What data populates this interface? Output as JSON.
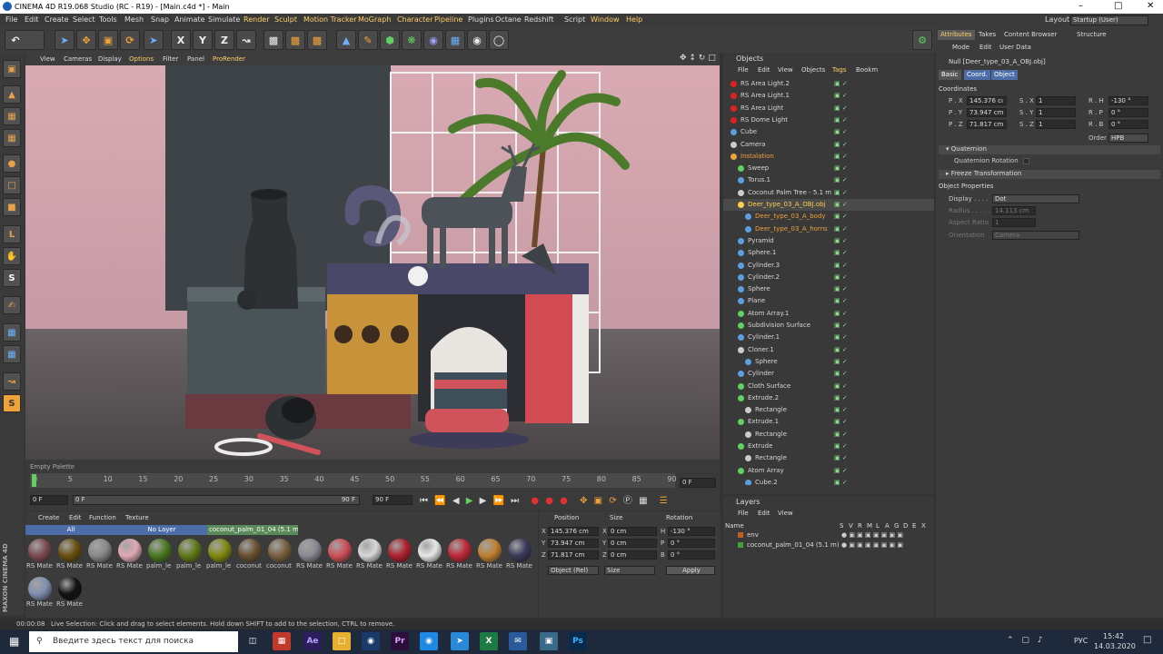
{
  "window": {
    "title": "CINEMA 4D R19.068 Studio (RC - R19) - [Main.c4d *] - Main"
  },
  "menu": {
    "items": [
      "File",
      "Edit",
      "Create",
      "Select",
      "Tools",
      "Mesh",
      "Snap",
      "Animate",
      "Simulate",
      "Render",
      "Sculpt",
      "Motion Tracker",
      "MoGraph",
      "Character",
      "Pipeline",
      "Plugins",
      "Octane",
      "Redshift",
      "Script",
      "Window",
      "Help"
    ],
    "layout_label": "Layout:",
    "layout_value": "Startup (User)"
  },
  "viewport_menu": {
    "items": [
      "View",
      "Cameras",
      "Display",
      "Options",
      "Filter",
      "Panel",
      "ProRender"
    ]
  },
  "timeline": {
    "ticks": [
      "0",
      "5",
      "10",
      "15",
      "20",
      "25",
      "30",
      "35",
      "40",
      "45",
      "50",
      "55",
      "60",
      "65",
      "70",
      "75",
      "80",
      "85",
      "90"
    ],
    "current_frame": "0 F",
    "start_frame": "0 F",
    "range_start": "0 F",
    "range_end": "90 F",
    "end_frame": "90 F",
    "palette_label": "Empty Palette"
  },
  "materials": {
    "menu": [
      "Create",
      "Edit",
      "Function",
      "Texture"
    ],
    "filters": [
      "All",
      "No Layer",
      "coconut_palm_01_04 (5.1 m)"
    ],
    "items": [
      {
        "label": "RS Mate",
        "color": "#7a4a50"
      },
      {
        "label": "RS Mate",
        "color": "#6a5010"
      },
      {
        "label": "RS Mate",
        "color": "#8a8a8a"
      },
      {
        "label": "RS Mate",
        "color": "#e0a8b4"
      },
      {
        "label": "palm_le",
        "color": "#4a7a20"
      },
      {
        "label": "palm_le",
        "color": "#607a18"
      },
      {
        "label": "palm_le",
        "color": "#808a10"
      },
      {
        "label": "coconut",
        "color": "#6a5030"
      },
      {
        "label": "coconut",
        "color": "#7a6040"
      },
      {
        "label": "RS Mate",
        "color": "#8a8a94"
      },
      {
        "label": "RS Mate",
        "color": "#d05058"
      },
      {
        "label": "RS Mate",
        "color": "#d8d8d8"
      },
      {
        "label": "RS Mate",
        "color": "#b02030"
      },
      {
        "label": "RS Mate",
        "color": "#e8e8e8"
      },
      {
        "label": "RS Mate",
        "color": "#c02838"
      },
      {
        "label": "RS Mate",
        "color": "#c08030"
      },
      {
        "label": "RS Mate",
        "color": "#3a3a5a"
      },
      {
        "label": "RS Mate",
        "color": "#8090b0"
      },
      {
        "label": "RS Mate",
        "color": "#111111"
      }
    ]
  },
  "coords": {
    "headers": [
      "Position",
      "Size",
      "Rotation"
    ],
    "rows": [
      {
        "axis": "X",
        "pos": "145.376 cm",
        "size_axis": "X",
        "size": "0 cm",
        "rot_axis": "H",
        "rot": "-130 °"
      },
      {
        "axis": "Y",
        "pos": "73.947 cm",
        "size_axis": "Y",
        "size": "0 cm",
        "rot_axis": "P",
        "rot": "0 °"
      },
      {
        "axis": "Z",
        "pos": "71.817 cm",
        "size_axis": "Z",
        "size": "0 cm",
        "rot_axis": "B",
        "rot": "0 °"
      }
    ],
    "mode": "Object (Rel)",
    "size_mode": "Size",
    "apply": "Apply"
  },
  "objects": {
    "title": "Objects",
    "menu": [
      "File",
      "Edit",
      "View",
      "Objects",
      "Tags",
      "Bookm"
    ],
    "rows": [
      {
        "name": "RS Area Light.2",
        "indent": 0,
        "color": "#e02020"
      },
      {
        "name": "RS Area Light.1",
        "indent": 0,
        "color": "#e02020"
      },
      {
        "name": "RS Area Light",
        "indent": 0,
        "color": "#e02020"
      },
      {
        "name": "RS Dome Light",
        "indent": 0,
        "color": "#e02020"
      },
      {
        "name": "Cube",
        "indent": 0,
        "color": "#5aa0e0"
      },
      {
        "name": "Camera",
        "indent": 0,
        "color": "#cccccc"
      },
      {
        "name": "Instalation",
        "indent": 0,
        "color": "#f0a23a",
        "orange": true
      },
      {
        "name": "Sweep",
        "indent": 1,
        "color": "#60d060"
      },
      {
        "name": "Torus.1",
        "indent": 1,
        "color": "#5aa0e0"
      },
      {
        "name": "Coconut Palm Tree - 5.1 m",
        "indent": 1,
        "color": "#cccccc"
      },
      {
        "name": "Deer_type_03_A_OBJ.obj",
        "indent": 1,
        "color": "#ffcf4a",
        "highlight": true
      },
      {
        "name": "Deer_type_03_A_body",
        "indent": 2,
        "color": "#5aa0e0",
        "orange": true
      },
      {
        "name": "Deer_type_03_A_horns",
        "indent": 2,
        "color": "#5aa0e0",
        "orange": true
      },
      {
        "name": "Pyramid",
        "indent": 1,
        "color": "#5aa0e0"
      },
      {
        "name": "Sphere.1",
        "indent": 1,
        "color": "#5aa0e0"
      },
      {
        "name": "Cylinder.3",
        "indent": 1,
        "color": "#5aa0e0"
      },
      {
        "name": "Cylinder.2",
        "indent": 1,
        "color": "#5aa0e0"
      },
      {
        "name": "Sphere",
        "indent": 1,
        "color": "#5aa0e0"
      },
      {
        "name": "Plane",
        "indent": 1,
        "color": "#5aa0e0"
      },
      {
        "name": "Atom Array.1",
        "indent": 1,
        "color": "#60d060"
      },
      {
        "name": "Subdivision Surface",
        "indent": 1,
        "color": "#60d060"
      },
      {
        "name": "Cylinder.1",
        "indent": 1,
        "color": "#5aa0e0"
      },
      {
        "name": "Cloner.1",
        "indent": 1,
        "color": "#cccccc"
      },
      {
        "name": "Sphere",
        "indent": 2,
        "color": "#5aa0e0"
      },
      {
        "name": "Cylinder",
        "indent": 1,
        "color": "#5aa0e0"
      },
      {
        "name": "Cloth Surface",
        "indent": 1,
        "color": "#60d060"
      },
      {
        "name": "Extrude.2",
        "indent": 1,
        "color": "#60d060"
      },
      {
        "name": "Rectangle",
        "indent": 2,
        "color": "#cccccc"
      },
      {
        "name": "Extrude.1",
        "indent": 1,
        "color": "#60d060"
      },
      {
        "name": "Rectangle",
        "indent": 2,
        "color": "#cccccc"
      },
      {
        "name": "Extrude",
        "indent": 1,
        "color": "#60d060"
      },
      {
        "name": "Rectangle",
        "indent": 2,
        "color": "#cccccc"
      },
      {
        "name": "Atom Array",
        "indent": 1,
        "color": "#60d060"
      },
      {
        "name": "Cube.2",
        "indent": 2,
        "color": "#5aa0e0"
      }
    ]
  },
  "layers": {
    "title": "Layers",
    "menu": [
      "File",
      "Edit",
      "View"
    ],
    "header_name": "Name",
    "header_flags": [
      "S",
      "V",
      "R",
      "M",
      "L",
      "A",
      "G",
      "D",
      "E",
      "X"
    ],
    "rows": [
      {
        "name": "env",
        "color": "#c06020"
      },
      {
        "name": "coconut_palm_01_04 (5.1 m)",
        "color": "#40a040"
      }
    ]
  },
  "attributes": {
    "tabs": [
      "Attributes",
      "Takes",
      "Content Browser",
      "Structure"
    ],
    "menu": [
      "Mode",
      "Edit",
      "User Data"
    ],
    "object_title": "Null [Deer_type_03_A_OBJ.obj]",
    "subtabs": [
      "Basic",
      "Coord.",
      "Object"
    ],
    "section_coords": "Coordinates",
    "coords": [
      {
        "p": "P . X",
        "pv": "145.376 cı",
        "s": "S . X",
        "sv": "1",
        "r": "R . H",
        "rv": "-130 °"
      },
      {
        "p": "P . Y",
        "pv": "73.947 cm",
        "s": "S . Y",
        "sv": "1",
        "r": "R . P",
        "rv": "0 °"
      },
      {
        "p": "P . Z",
        "pv": "71.817 cm",
        "s": "S . Z",
        "sv": "1",
        "r": "R . B",
        "rv": "0 °"
      }
    ],
    "order_label": "Order",
    "order_value": "HPB",
    "quaternion": "Quaternion",
    "quaternion_rotation": "Quaternion Rotation",
    "freeze": "Freeze Transformation",
    "object_properties": "Object Properties",
    "display_label": "Display . . . .",
    "display_value": "Dot",
    "radius_label": "Radius . . . . .",
    "radius_value": "14.113 cm",
    "aspect_label": "Aspect Ratio",
    "aspect_value": "1",
    "orientation_label": "Orientation",
    "orientation_value": "Camera"
  },
  "status": {
    "time": "00:00:08",
    "message": "Live Selection: Click and drag to select elements. Hold down SHIFT to add to the selection, CTRL to remove."
  },
  "taskbar": {
    "search_placeholder": "Введите здесь текст для поиска",
    "lang": "РУС",
    "time": "15:42",
    "date": "14.03.2020"
  },
  "brand": {
    "maxon": "MAXON",
    "c4d": "CINEMA 4D"
  }
}
